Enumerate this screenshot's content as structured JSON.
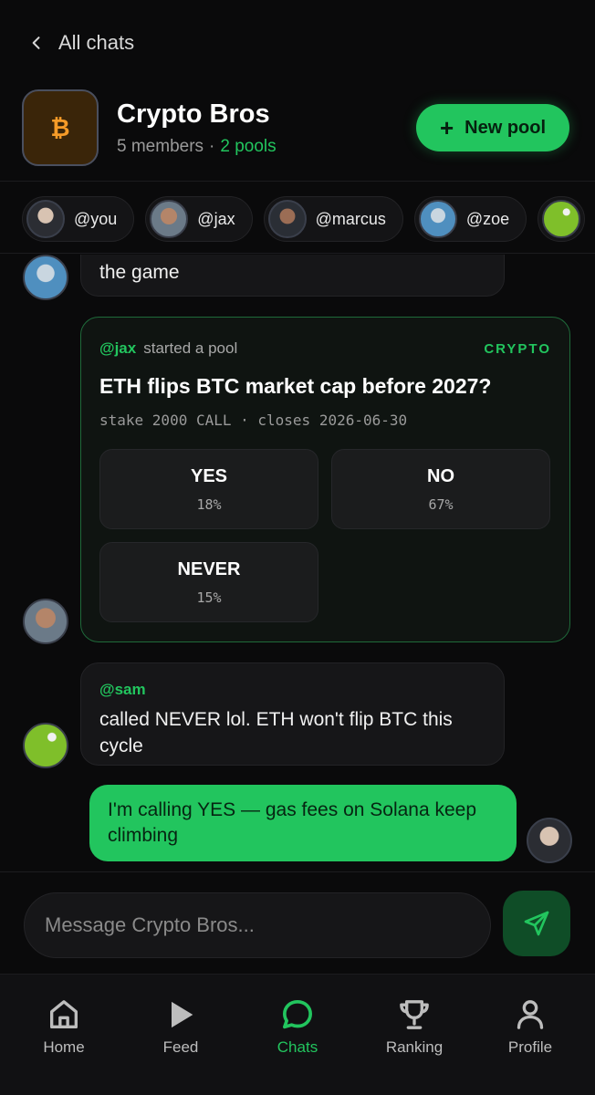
{
  "nav": {
    "back_label": "All chats"
  },
  "group": {
    "icon_glyph": "₿",
    "name": "Crypto Bros",
    "members_text": "5 members",
    "separator": "·",
    "pools_text": "2 pools",
    "accent_color": "#22c55e"
  },
  "actions": {
    "new_pool_icon": "+",
    "new_pool_label": "New pool"
  },
  "members": [
    {
      "handle": "@you"
    },
    {
      "handle": "@jax"
    },
    {
      "handle": "@marcus"
    },
    {
      "handle": "@zoe"
    }
  ],
  "messages": {
    "partial_text": "the game",
    "pool": {
      "creator": "@jax",
      "action": "started a pool",
      "category": "CRYPTO",
      "question": "ETH flips BTC market cap before 2027?",
      "meta": "stake 2000 CALL · closes 2026-06-30",
      "options": [
        {
          "label": "YES",
          "percent": "18%"
        },
        {
          "label": "NO",
          "percent": "67%"
        },
        {
          "label": "NEVER",
          "percent": "15%"
        }
      ]
    },
    "sam": {
      "sender": "@sam",
      "text": "called NEVER lol. ETH won't flip BTC this cycle"
    },
    "mine": {
      "text": "I'm calling YES — gas fees on Solana keep climbing"
    }
  },
  "composer": {
    "placeholder": "Message Crypto Bros..."
  },
  "tabs": [
    {
      "label": "Home",
      "icon": "home-icon"
    },
    {
      "label": "Feed",
      "icon": "play-icon"
    },
    {
      "label": "Chats",
      "icon": "chat-bubble-icon",
      "active": true
    },
    {
      "label": "Ranking",
      "icon": "trophy-icon"
    },
    {
      "label": "Profile",
      "icon": "user-icon"
    }
  ]
}
